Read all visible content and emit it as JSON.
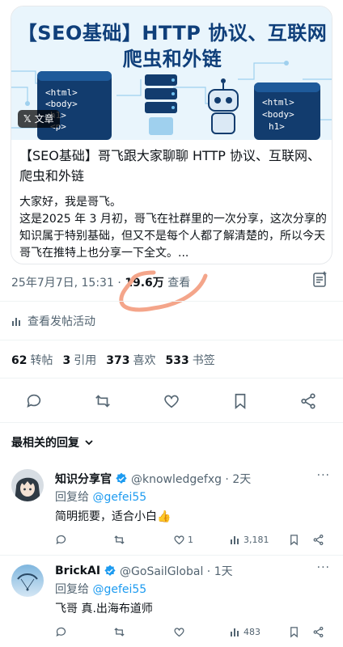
{
  "article": {
    "banner_title_line1": "【SEO基础】HTTP 协议、互联网",
    "banner_title_line2": "爬虫和外链",
    "badge_label": "文章",
    "title": "【SEO基础】哥飞跟大家聊聊 HTTP 协议、互联网、爬虫和外链",
    "body": "大家好，我是哥飞。\n这是2025 年 3 月初，哥飞在社群里的一次分享，这次分享的知识属于特别基础，但又不是每个人都了解清楚的，所以今天哥飞在推特上也分享一下全文。..."
  },
  "meta": {
    "date_time": "25年7月7日, 15:31",
    "separator": " · ",
    "views_count": "19.6万",
    "views_label": " 查看"
  },
  "activity_label": "查看发帖活动",
  "stats": [
    {
      "n": "62",
      "label": "转帖"
    },
    {
      "n": "3",
      "label": "引用"
    },
    {
      "n": "373",
      "label": "喜欢"
    },
    {
      "n": "533",
      "label": "书签"
    }
  ],
  "sort_label": "最相关的回复",
  "replies": [
    {
      "name": "知识分享官",
      "handle": "@knowledgefxg · 2天",
      "reply_to_label": "回复给 ",
      "reply_to": "@gefei55",
      "text": "简明扼要，适合小白👍",
      "likes": "1",
      "views": "3,181"
    },
    {
      "name": "BrickAI",
      "handle": "@GoSailGlobal · 1天",
      "reply_to_label": "回复给 ",
      "reply_to": "@gefei55",
      "text": "飞哥 真.出海布道师",
      "likes": "",
      "views": "483"
    }
  ],
  "colors": {
    "accent": "#1d9bf0",
    "verified": "#1d9bf0",
    "secondary_text": "#536471",
    "annotation": "#f4a58a"
  }
}
